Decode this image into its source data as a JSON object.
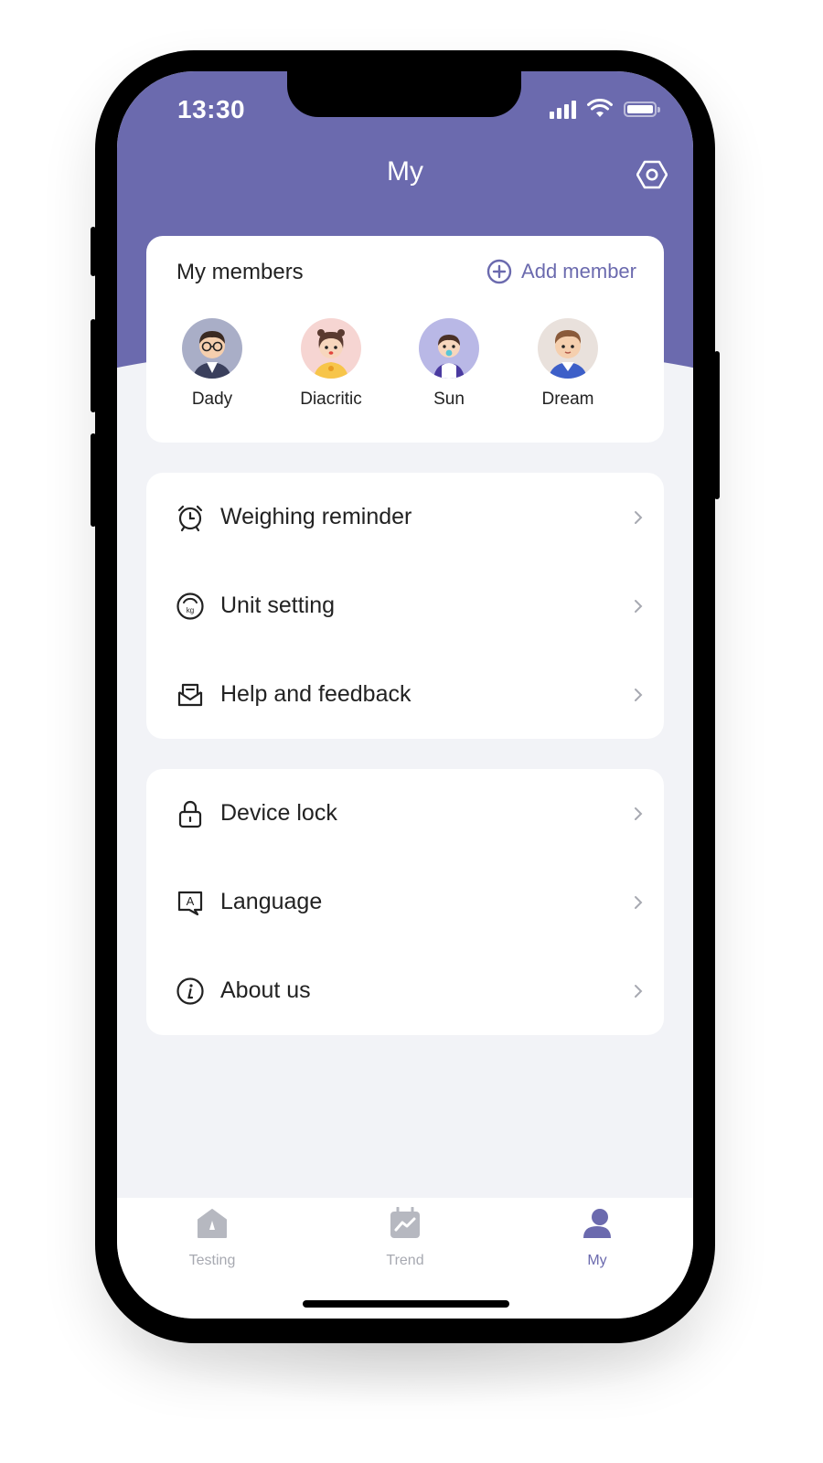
{
  "status_bar": {
    "time": "13:30"
  },
  "header": {
    "title": "My"
  },
  "members": {
    "title": "My members",
    "add_label": "Add member",
    "items": [
      {
        "name": "Dady"
      },
      {
        "name": "Diacritic"
      },
      {
        "name": "Sun"
      },
      {
        "name": "Dream"
      }
    ]
  },
  "menu_group_1": [
    {
      "label": "Weighing reminder",
      "icon": "alarm-clock-icon"
    },
    {
      "label": "Unit setting",
      "icon": "kg-gauge-icon"
    },
    {
      "label": "Help and feedback",
      "icon": "mail-icon"
    }
  ],
  "menu_group_2": [
    {
      "label": "Device lock",
      "icon": "lock-icon"
    },
    {
      "label": "Language",
      "icon": "language-icon"
    },
    {
      "label": "About us",
      "icon": "info-icon"
    }
  ],
  "tabs": [
    {
      "label": "Testing",
      "icon": "home-icon",
      "active": false
    },
    {
      "label": "Trend",
      "icon": "trend-icon",
      "active": false
    },
    {
      "label": "My",
      "icon": "person-icon",
      "active": true
    }
  ],
  "colors": {
    "accent": "#6b6aae",
    "background": "#f2f3f7",
    "inactive": "#a7a9b1"
  }
}
